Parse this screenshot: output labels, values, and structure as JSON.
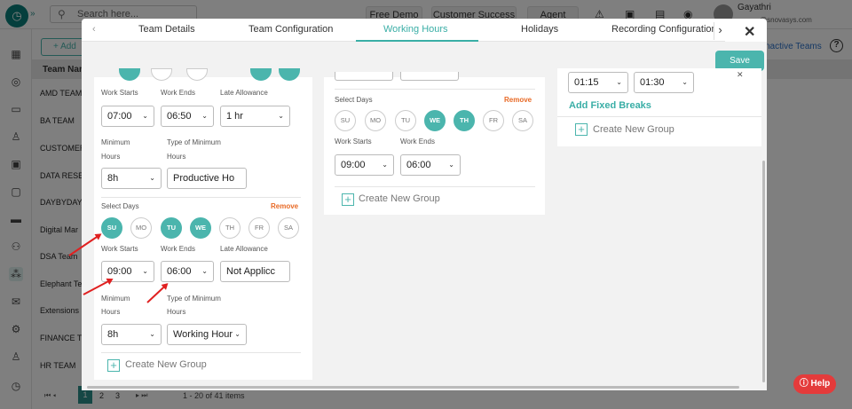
{
  "topbar": {
    "search_placeholder": "Search here...",
    "buttons": [
      "Free Demo",
      "Customer Success",
      "Agent"
    ],
    "user_name": "Gayathri",
    "user_email": "@snovasys.com"
  },
  "page": {
    "add_label": "+ Add",
    "inactive_teams_link": "nactive Teams",
    "column_header": "Team Nam",
    "teams": [
      "AMD TEAM",
      "BA TEAM",
      "CUSTOMER",
      "DATA RESEA",
      "DAYBYDAY",
      "Digital Mar",
      "DSA Team",
      "Elephant Te",
      "Extensions",
      "FINANCE TE",
      "HR TEAM"
    ],
    "pagination": {
      "pages": [
        "1",
        "2",
        "3"
      ],
      "range": "1 - 20 of 41 items"
    }
  },
  "modal": {
    "tabs": [
      "Team Details",
      "Team Configuration",
      "Working Hours",
      "Holidays",
      "Recording Configuration"
    ],
    "active_tab": "Working Hours",
    "save_label": "Save",
    "labels": {
      "work_starts": "Work Starts",
      "work_ends": "Work Ends",
      "late_allowance": "Late Allowance",
      "minimum_hours_1": "Minimum",
      "minimum_hours_2": "Hours",
      "type_of_minimum_1": "Type of Minimum",
      "type_of_minimum_2": "Hours",
      "select_days": "Select Days",
      "remove": "Remove",
      "create_new_group": "Create New Group",
      "add_fixed_breaks": "Add Fixed Breaks"
    },
    "days": [
      "SU",
      "MO",
      "TU",
      "WE",
      "TH",
      "FR",
      "SA"
    ],
    "left_group1": {
      "work_starts": "07:00",
      "work_ends": "06:50",
      "late_allowance": "1 hr",
      "minimum_hours": "8h",
      "type_of_minimum": "Productive Ho"
    },
    "left_group2": {
      "work_starts": "09:00",
      "work_ends": "06:00",
      "late_allowance": "Not Applicc",
      "minimum_hours": "8h",
      "type_of_minimum": "Working Hour"
    },
    "middle_group": {
      "work_starts": "09:00",
      "work_ends": "06:00"
    },
    "right_breaks": {
      "from": "01:15",
      "to": "01:30"
    }
  },
  "help_label": "Help"
}
